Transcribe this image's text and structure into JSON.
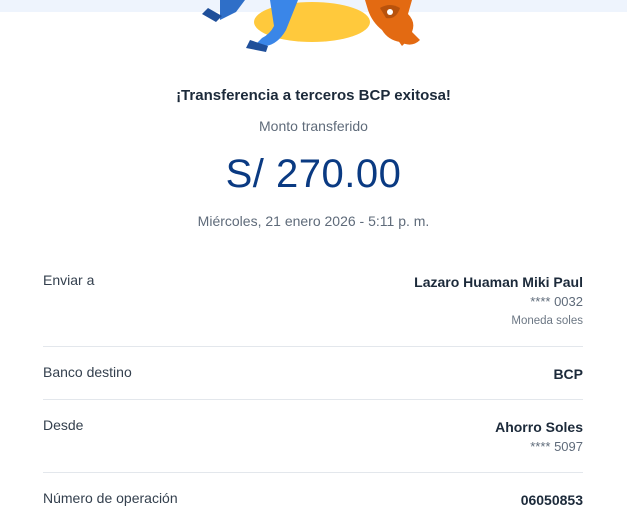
{
  "receipt": {
    "title": "¡Transferencia a terceros BCP exitosa!",
    "amount_label": "Monto transferido",
    "amount": "S/ 270.00",
    "datetime": "Miércoles, 21 enero 2026 - 5:11 p. m."
  },
  "details": {
    "recipient": {
      "label": "Enviar a",
      "name": "Lazaro Huaman Miki Paul",
      "account": "**** 0032",
      "currency": "Moneda soles"
    },
    "bank": {
      "label": "Banco destino",
      "value": "BCP"
    },
    "source": {
      "label": "Desde",
      "account_name": "Ahorro Soles",
      "account": "**** 5097"
    },
    "operation": {
      "label": "Número de operación",
      "value": "06050853"
    }
  },
  "colors": {
    "amount": "#0a3a82",
    "illustration_blue": "#3a86e8",
    "illustration_orange": "#f07a1a",
    "illustration_yellow": "#ffc93c"
  }
}
